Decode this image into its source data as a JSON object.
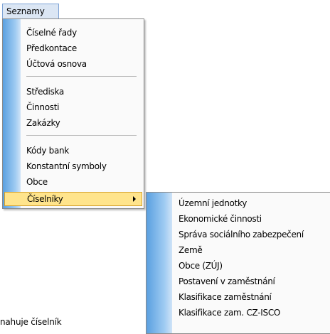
{
  "menubar": {
    "title": "Seznamy",
    "hotkey_char": "z"
  },
  "menu": {
    "items": [
      {
        "label": "Číselné řady"
      },
      {
        "label": "Předkontace"
      },
      {
        "label": "Účtová osnova"
      },
      {
        "label": "Střediska"
      },
      {
        "label": "Činnosti"
      },
      {
        "label": "Zakázky"
      },
      {
        "label": "Kódy bank"
      },
      {
        "label": "Konstantní symboly"
      },
      {
        "label": "Obce"
      },
      {
        "label": "Číselníky"
      }
    ]
  },
  "submenu": {
    "items": [
      {
        "label": "Územní jednotky"
      },
      {
        "label": "Ekonomické činnosti"
      },
      {
        "label": "Správa sociálního zabezpečení"
      },
      {
        "label": "Země"
      },
      {
        "label": "Obce (ZÚJ)"
      },
      {
        "label": "Postavení v zaměstnání"
      },
      {
        "label": "Klasifikace zaměstnání"
      },
      {
        "label": "Klasifikace zam. CZ-ISCO"
      }
    ]
  },
  "background_text": "nahuje  číselník",
  "colors": {
    "highlight": "#ffe48c",
    "gutter": "#5aa0e0",
    "menubar_active": "#dbe6f4"
  }
}
